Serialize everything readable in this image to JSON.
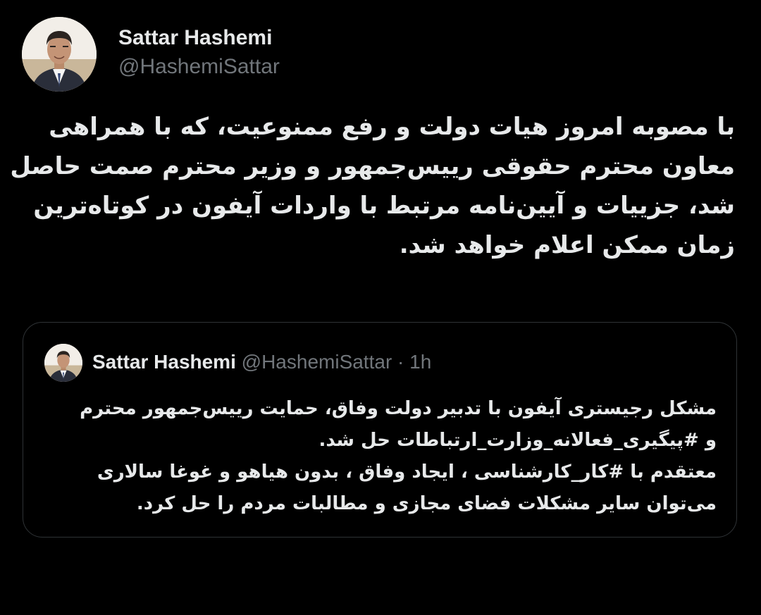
{
  "tweet": {
    "author_name": "Sattar Hashemi",
    "author_handle": "@HashemiSattar",
    "avatar_icon": "user-photo-icon",
    "text_lines": [
      "با مصوبه امروز هیات دولت و رفع ممنوعیت، که با همراهی",
      "معاون محترم حقوقی رییس‌جمهور و وزیر محترم صمت حاصل",
      "شد، جزییات و آیین‌نامه مرتبط با واردات آیفون در کوتاه‌ترین",
      "زمان ممکن اعلام خواهد شد."
    ]
  },
  "quoted_tweet": {
    "author_name": "Sattar Hashemi",
    "author_handle": "@HashemiSattar",
    "separator": "·",
    "time": "1h",
    "avatar_icon": "user-photo-icon",
    "text_lines": [
      "مشکل رجیستری آیفون با تدبیر دولت  وفاق، حمایت  رییس‌جمهور محترم",
      "و #پیگیری_فعالانه_وزارت_ارتباطات حل شد.",
      "معتقدم با #کار_کارشناسی ، ایجاد وفاق ، بدون هیاهو و غوغا سالاری",
      "می‌توان سایر مشکلات فضای مجازی و مطالبات مردم را حل کرد."
    ]
  },
  "colors": {
    "background": "#000000",
    "text_primary": "#e7e9ea",
    "text_secondary": "#71767b",
    "border": "#2f3336"
  }
}
